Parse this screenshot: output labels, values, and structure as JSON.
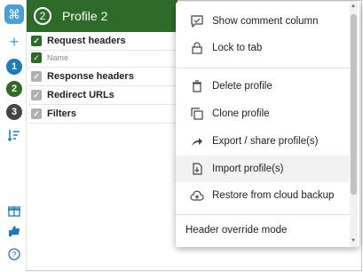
{
  "header": {
    "profile_number": "2",
    "profile_title": "Profile 2"
  },
  "sidebar": {
    "items": [
      "1",
      "2",
      "3"
    ]
  },
  "rows": [
    {
      "label": "Request headers",
      "checked": true
    },
    {
      "label": "Name",
      "checked": true
    },
    {
      "label": "Response headers",
      "checked": false
    },
    {
      "label": "Redirect URLs",
      "checked": false
    },
    {
      "label": "Filters",
      "checked": false
    }
  ],
  "menu": {
    "items": [
      {
        "label": "Show comment column",
        "icon": "comment-icon"
      },
      {
        "label": "Lock to tab",
        "icon": "lock-icon"
      },
      {
        "label": "Delete profile",
        "icon": "trash-icon"
      },
      {
        "label": "Clone profile",
        "icon": "copy-icon"
      },
      {
        "label": "Export / share profile(s)",
        "icon": "share-icon"
      },
      {
        "label": "Import profile(s)",
        "icon": "import-icon"
      },
      {
        "label": "Restore from cloud backup",
        "icon": "cloud-icon"
      }
    ],
    "section_label": "Header override mode"
  },
  "colors": {
    "header_bg": "#2e6b28",
    "accent": "#4a9fd8"
  }
}
